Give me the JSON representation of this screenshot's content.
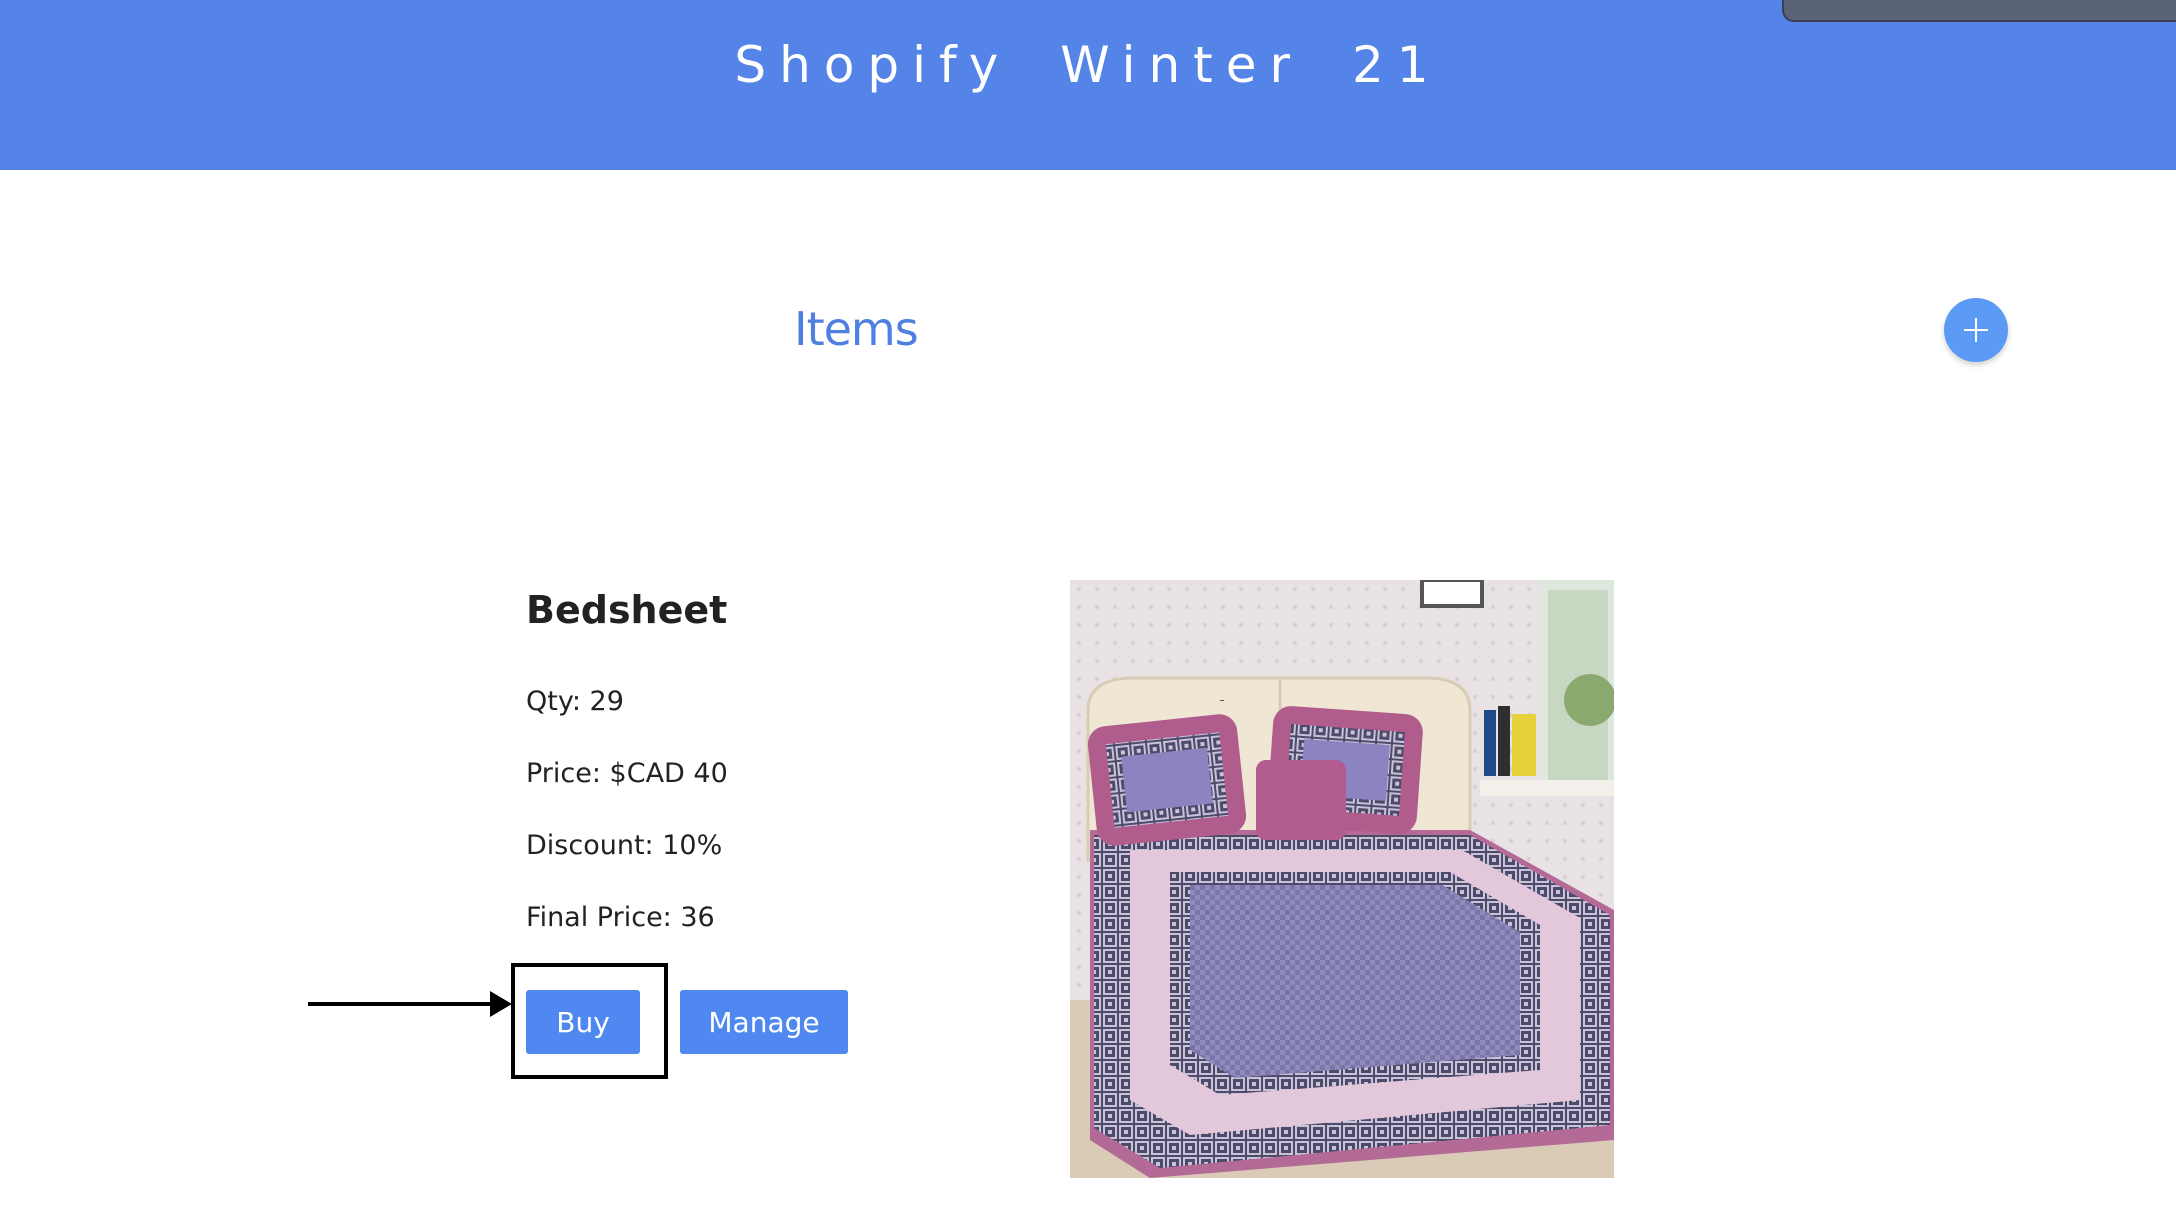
{
  "header": {
    "title": "Shopify  Winter  21"
  },
  "main": {
    "section_title": "Items",
    "add_icon": "plus-icon"
  },
  "item": {
    "name": "Bedsheet",
    "qty": "Qty: 29",
    "price": "Price: $CAD 40",
    "discount": "Discount: 10%",
    "final_price": "Final Price: 36",
    "buy_label": "Buy",
    "manage_label": "Manage",
    "image_alt": "Bedsheet"
  },
  "colors": {
    "header": "#5484e8",
    "accent": "#4f88f0",
    "items_title": "#4f7fe0"
  }
}
